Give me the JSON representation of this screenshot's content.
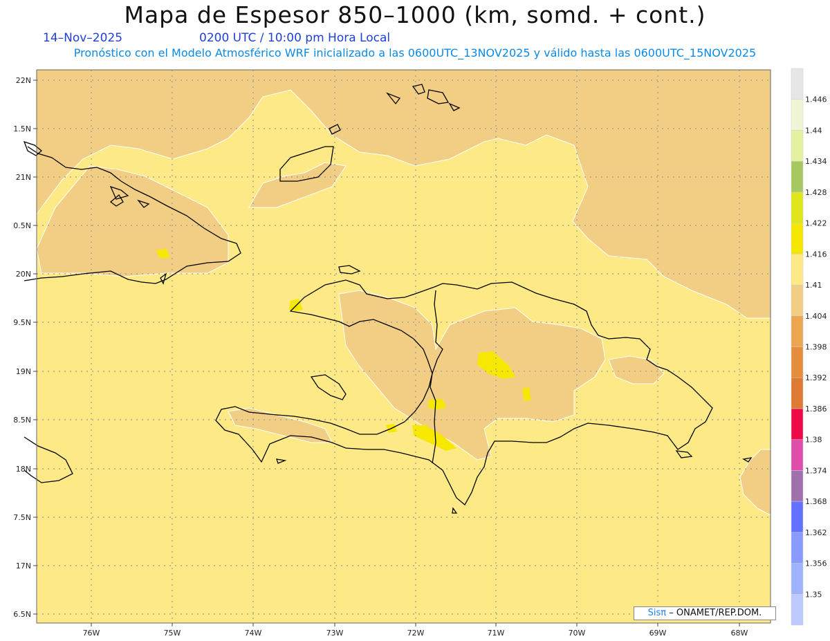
{
  "header": {
    "title": "Mapa de Espesor 850–1000 (km, somd. + cont.)",
    "date": "14–Nov–2025",
    "time": "0200 UTC / 10:00 pm Hora Local",
    "subtitle": "Pronóstico con el Modelo Atmosférico WRF inicializado a las 0600UTC_13NOV2025 y válido hasta las  0600UTC_15NOV2025"
  },
  "map": {
    "lon_range": [
      -76.65,
      -67.6
    ],
    "lat_range": [
      16.35,
      22.1
    ],
    "lat_labels": [
      "22N",
      "1.5N",
      "21N",
      "0.5N",
      "20N",
      "9.5N",
      "19N",
      "8.5N",
      "18N",
      "7.5N",
      "17N",
      "6.5N"
    ],
    "lon_labels": [
      "76W",
      "75W",
      "74W",
      "73W",
      "72W",
      "71W",
      "70W",
      "69W",
      "68W"
    ],
    "colors": {
      "background_field": "#fde986",
      "lower_field": "#f2ce85",
      "peak": "#f7e800",
      "coast": "#000000",
      "grid": "#9a9a9a"
    }
  },
  "colorbar": {
    "labels": [
      "1.35",
      "1.356",
      "1.362",
      "1.368",
      "1.374",
      "1.38",
      "1.386",
      "1.392",
      "1.398",
      "1.404",
      "1.41",
      "1.416",
      "1.422",
      "1.428",
      "1.434",
      "1.44",
      "1.446"
    ],
    "colors": [
      "#bccaff",
      "#9fb2ff",
      "#8a9bff",
      "#6470ff",
      "#9f6fae",
      "#e14eaa",
      "#ee0a47",
      "#df7a34",
      "#e58d3c",
      "#eca650",
      "#f2ce85",
      "#fde986",
      "#f6e700",
      "#dfe61b",
      "#a7c861",
      "#e2f29f",
      "#f0f5d6",
      "#e6e6e6"
    ]
  },
  "credit": {
    "sis": "Sisπ",
    "rest": "– ONAMET/REP.DOM."
  }
}
